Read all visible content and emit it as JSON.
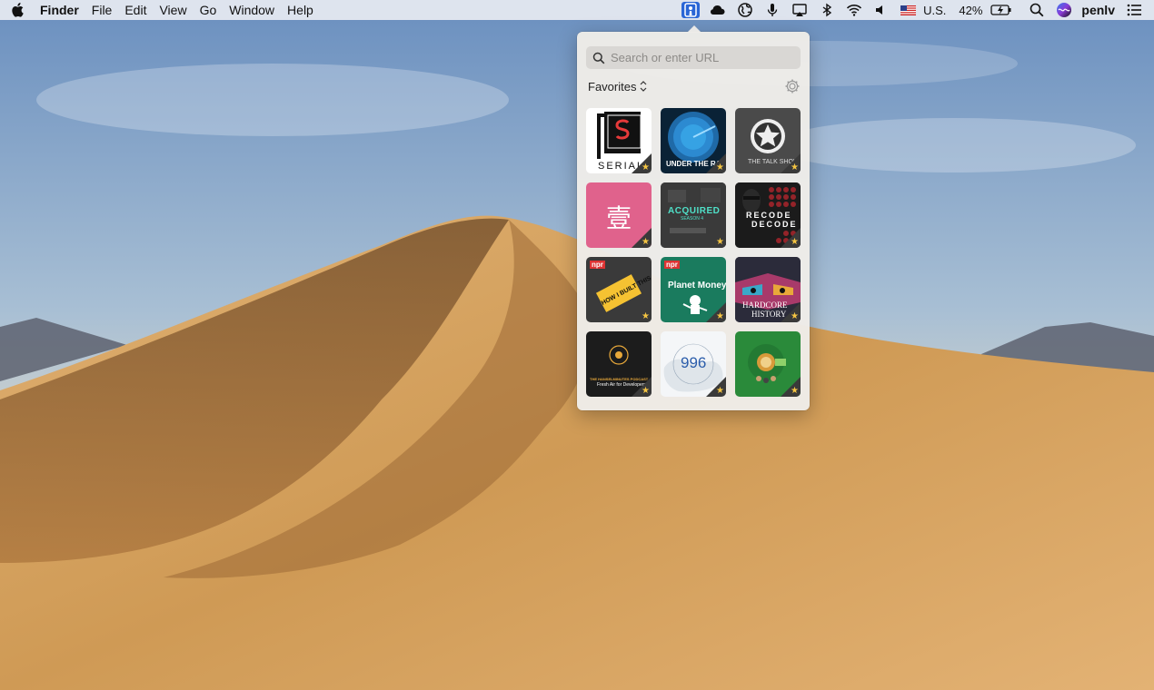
{
  "menubar": {
    "app_name": "Finder",
    "menus": [
      "File",
      "Edit",
      "View",
      "Go",
      "Window",
      "Help"
    ],
    "input_source": "U.S.",
    "battery": "42%",
    "user": "penlv",
    "icons": [
      "podcast-icon",
      "cloud-icon",
      "globe-icon",
      "microphone-icon",
      "airplay-icon",
      "bluetooth-icon",
      "wifi-icon",
      "volume-icon",
      "flag-us-icon",
      "battery-charging-icon",
      "spotlight-search-icon",
      "siri-icon",
      "notification-center-icon"
    ]
  },
  "popover": {
    "search_placeholder": "Search or enter URL",
    "filter_label": "Favorites",
    "tiles": [
      {
        "name": "serial",
        "text": "SERIAL",
        "bg": "#ffffff"
      },
      {
        "name": "under-the-radar",
        "text": "UNDER THE RADAR",
        "bg": "#0a2236"
      },
      {
        "name": "the-talk-show",
        "text": "THE TALK SHOW",
        "bg": "#4a4a4a"
      },
      {
        "name": "yi",
        "text": "壹",
        "bg": "#e0628c"
      },
      {
        "name": "acquired",
        "text": "ACQUIRED",
        "sub": "SEASON 4",
        "bg": "#2b2b2b"
      },
      {
        "name": "recode-decode",
        "text": "RECODE",
        "sub": "DECODE",
        "bg": "#1b1b1b"
      },
      {
        "name": "how-i-built-this",
        "text": "HOW I BUILT THIS",
        "badge": "npr",
        "bg": "#3a3a3a"
      },
      {
        "name": "planet-money",
        "text": "Planet Money",
        "badge": "npr",
        "bg": "#1a7b5e"
      },
      {
        "name": "hardcore-history",
        "text": "HARDCORE",
        "sub": "HISTORY",
        "bg": "#242433"
      },
      {
        "name": "hanselminutes",
        "text": "THE HANSELMINUTES PODCAST",
        "sub": "Fresh Air for Developers",
        "bg": "#1c1c1c"
      },
      {
        "name": "996",
        "text": "996",
        "bg": "#f4f6f8"
      },
      {
        "name": "green-tea",
        "text": "",
        "bg": "#2a8a3a"
      }
    ]
  },
  "colors": {
    "accent": "#2a66d6",
    "star": "#f5c542"
  }
}
